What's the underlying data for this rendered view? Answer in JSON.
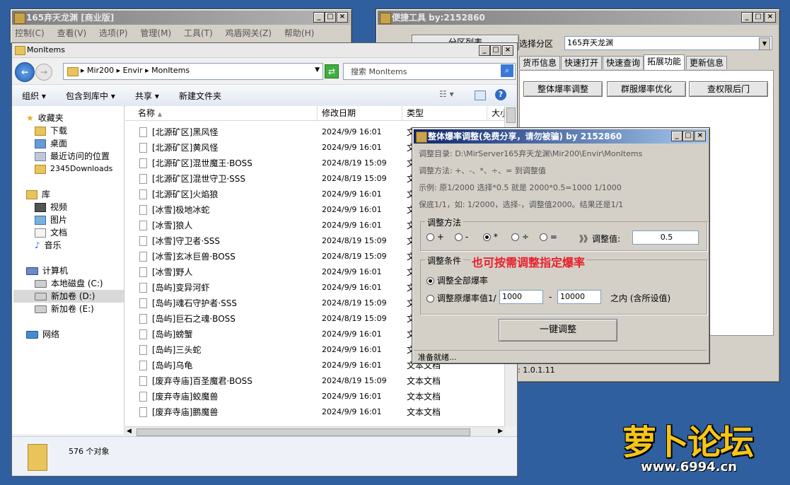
{
  "desktop": {
    "bg": "#2f5f9e"
  },
  "app_main": {
    "title": "165弃天龙渊 [商业版]",
    "menu": [
      "控制(C)",
      "查看(V)",
      "选项(P)",
      "管理(M)",
      "工具(T)",
      "鸡盾网关(Z)",
      "帮助(H)"
    ]
  },
  "explorer": {
    "title": "MonItems",
    "address": "▸ Mir200 ▸ Envir ▸ MonItems",
    "search_placeholder": "搜索 MonItems",
    "toolbar": [
      "组织 ▾",
      "包含到库中 ▾",
      "共享 ▾",
      "新建文件夹"
    ],
    "sidebar": {
      "favorites": "收藏夹",
      "fav_items": [
        "下载",
        "桌面",
        "最近访问的位置",
        "2345Downloads"
      ],
      "library": "库",
      "lib_items": [
        "视频",
        "图片",
        "文档",
        "音乐"
      ],
      "computer": "计算机",
      "drives": [
        "本地磁盘 (C:)",
        "新加卷 (D:)",
        "新加卷 (E:)"
      ],
      "network": "网络"
    },
    "columns": [
      "名称",
      "修改日期",
      "类型",
      "大小"
    ],
    "rows": [
      {
        "name": "[北源矿区]黑风怪",
        "date": "2024/9/9 16:01",
        "type": "文本文档"
      },
      {
        "name": "[北源矿区]黄风怪",
        "date": "2024/9/9 16:01",
        "type": "文本文档"
      },
      {
        "name": "[北源矿区]混世魔王·BOSS",
        "date": "2024/8/19 15:09",
        "type": "文本文档"
      },
      {
        "name": "[北源矿区]混世守卫·SSS",
        "date": "2024/8/19 15:09",
        "type": "文本文档"
      },
      {
        "name": "[北源矿区]火焰狼",
        "date": "2024/9/9 16:01",
        "type": "文本文档"
      },
      {
        "name": "[冰雪]极地冰蛇",
        "date": "2024/9/9 16:01",
        "type": "文本文档"
      },
      {
        "name": "[冰雪]狼人",
        "date": "2024/9/9 16:01",
        "type": "文本文档"
      },
      {
        "name": "[冰雪]守卫者·SSS",
        "date": "2024/8/19 15:09",
        "type": "文本文档"
      },
      {
        "name": "[冰雪]玄冰巨兽·BOSS",
        "date": "2024/8/19 15:09",
        "type": "文本文档"
      },
      {
        "name": "[冰雪]野人",
        "date": "2024/9/9 16:01",
        "type": "文本文档"
      },
      {
        "name": "[岛屿]变异河虾",
        "date": "2024/9/9 16:01",
        "type": "文本文档"
      },
      {
        "name": "[岛屿]魂石守护者·SSS",
        "date": "2024/8/19 15:09",
        "type": "文本文档"
      },
      {
        "name": "[岛屿]巨石之魂·BOSS",
        "date": "2024/8/19 15:09",
        "type": "文本文档"
      },
      {
        "name": "[岛屿]螃蟹",
        "date": "2024/9/9 16:01",
        "type": "文本文档"
      },
      {
        "name": "[岛屿]三头蛇",
        "date": "2024/9/9 16:01",
        "type": "文本文档"
      },
      {
        "name": "[岛屿]乌龟",
        "date": "2024/9/9 16:01",
        "type": "文本文档"
      },
      {
        "name": "[废弃寺庙]百圣魔君·BOSS",
        "date": "2024/8/19 15:09",
        "type": "文本文档"
      },
      {
        "name": "[废弃寺庙]蛟魔兽",
        "date": "2024/9/9 16:01",
        "type": "文本文档"
      },
      {
        "name": "[废弃寺庙]鹏魔兽",
        "date": "2024/9/9 16:01",
        "type": "文本文档"
      }
    ],
    "status": "576 个对象"
  },
  "tools": {
    "title": "便捷工具   by:2152860",
    "left_button": "分区列表",
    "partition_label": "选择分区",
    "partition_value": "165弃天龙渊",
    "tabs": [
      "货币信息",
      "快速打开",
      "快速查询",
      "拓展功能",
      "更新信息"
    ],
    "buttons": [
      "整体爆率调整",
      "群服爆率优化",
      "查权限后门"
    ],
    "version": ": 1.0.1.11"
  },
  "dialog": {
    "title": "整体爆率调整(免费分享，请勿被骗)   by 2152860",
    "dir_line": "调整目录: D:\\MirServer165弃天龙渊\\Mir200\\Envir\\MonItems",
    "method_line": "调整方法: +、-、*、÷、=   到调整值",
    "example_line": "示例: 原1/2000 选择*0.5 就是 2000*0.5=1000  1/1000",
    "floor_line": "保底1/1，如: 1/2000，选择-，调整值2000。结果还是1/1",
    "method_group": "调整方法",
    "ops": [
      "+",
      "-",
      "*",
      "÷",
      "="
    ],
    "value_label": "》》调整值:",
    "value": "0.5",
    "cond_group": "调整条件",
    "annotation": "也可按需调整指定爆率",
    "opt_all": "调整全部爆率",
    "opt_range": "调整原爆率值1/",
    "range_from": "1000",
    "range_to": "10000",
    "range_suffix": "之内 (含所设值)",
    "dash": "-",
    "run_button": "一键调整",
    "status": "准备就绪..."
  },
  "watermark": {
    "logo": "萝卜论坛",
    "url": "www.6994.cn"
  }
}
